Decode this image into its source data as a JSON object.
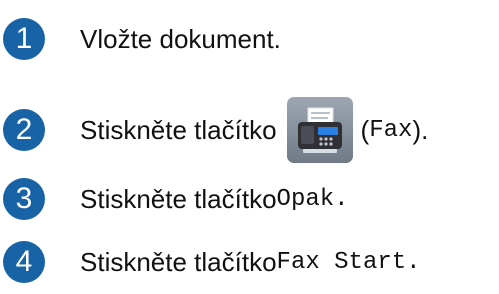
{
  "steps": [
    {
      "number": "1",
      "text": "Vložte dokument."
    },
    {
      "number": "2",
      "text": "Stiskněte tlačítko ",
      "button_suffix_open": "(",
      "button_code": "Fax",
      "button_suffix_close": ")."
    },
    {
      "number": "3",
      "text": "Stiskněte tlačítko ",
      "code": "Opak",
      "end": "."
    },
    {
      "number": "4",
      "text": "Stiskněte tlačítko ",
      "code": "Fax Start",
      "end": "."
    }
  ],
  "icons": {
    "fax": "fax-machine-icon"
  },
  "colors": {
    "step_circle": "#1763a6",
    "fax_button_bg": "#7f8994"
  }
}
